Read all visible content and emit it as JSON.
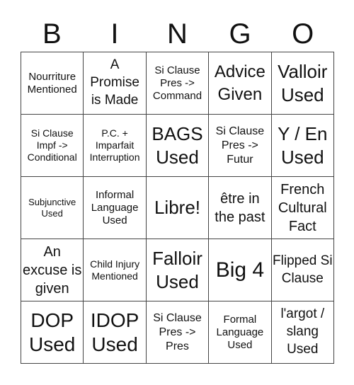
{
  "header": [
    "B",
    "I",
    "N",
    "G",
    "O"
  ],
  "cells": [
    "Nourriture Mentioned",
    "A Promise is Made",
    "Si Clause Pres -> Command",
    "Advice Given",
    "Valloir Used",
    "Si Clause Impf -> Conditional",
    "P.C. + Imparfait Interruption",
    "BAGS Used",
    "Si Clause Pres -> Futur",
    "Y / En Used",
    "Subjunctive Used",
    "Informal Language Used",
    "Libre!",
    "être in the past",
    "French Cultural Fact",
    "An excuse is given",
    "Child Injury Mentioned",
    "Falloir Used",
    "Big 4",
    "Flipped Si Clause",
    "DOP Used",
    "IDOP Used",
    "Si Clause Pres -> Pres",
    "Formal Language Used",
    "l'argot / slang Used"
  ]
}
